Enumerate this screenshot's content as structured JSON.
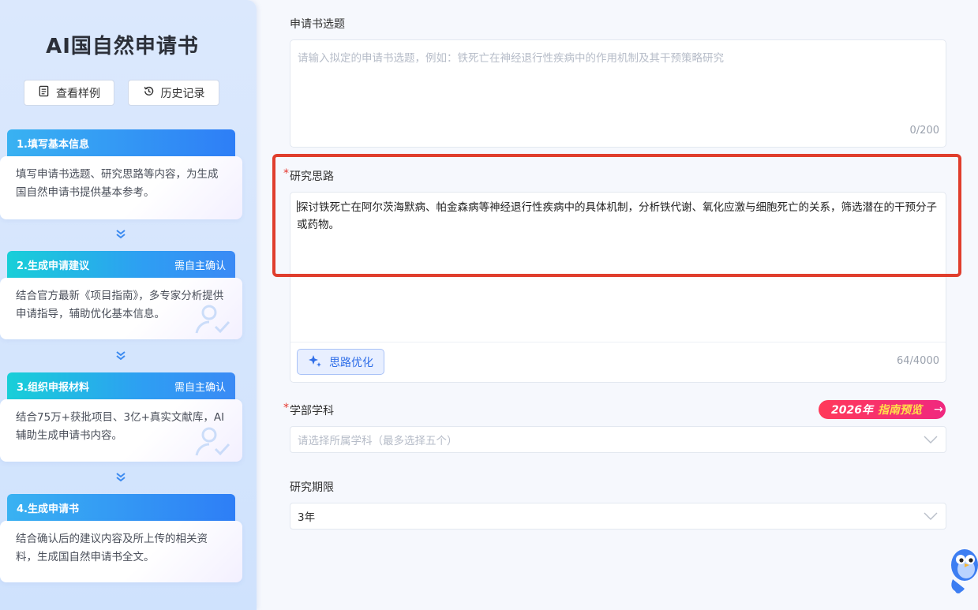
{
  "sidebar": {
    "title": "AI国自然申请书",
    "sample_button": "查看样例",
    "history_button": "历史记录",
    "steps": [
      {
        "title": "1.填写基本信息",
        "badge": "",
        "desc": "填写申请书选题、研究思路等内容，为生成国自然申请书提供基本参考。"
      },
      {
        "title": "2.生成申请建议",
        "badge": "需自主确认",
        "desc": "结合官方最新《项目指南》，多专家分析提供申请指导，辅助优化基本信息。"
      },
      {
        "title": "3.组织申报材料",
        "badge": "需自主确认",
        "desc": "结合75万+获批项目、3亿+真实文献库，AI辅助生成申请书内容。"
      },
      {
        "title": "4.生成申请书",
        "badge": "",
        "desc": "结合确认后的建议内容及所上传的相关资料，生成国自然申请书全文。"
      }
    ]
  },
  "form": {
    "topic": {
      "label": "申请书选题",
      "placeholder": "请输入拟定的申请书选题，例如：铁死亡在神经退行性疾病中的作用机制及其干预策略研究",
      "value": "",
      "counter": "0/200"
    },
    "idea": {
      "required_mark": "*",
      "label": "研究思路",
      "value": "探讨铁死亡在阿尔茨海默病、帕金森病等神经退行性疾病中的具体机制，分析铁代谢、氧化应激与细胞死亡的关系，筛选潜在的干预分子或药物。",
      "optimize_button": "思路优化",
      "counter": "64/4000"
    },
    "discipline": {
      "required_mark": "*",
      "label": "学部学科",
      "placeholder": "请选择所属学科（最多选择五个）",
      "guide_year": "2026年",
      "guide_text": "指南预览",
      "guide_arrow": "→"
    },
    "period": {
      "label": "研究期限",
      "value": "3年"
    }
  },
  "colors": {
    "accent": "#2e7ef6",
    "highlight_frame": "#e03e2d",
    "guide_badge": "#f0287f"
  }
}
